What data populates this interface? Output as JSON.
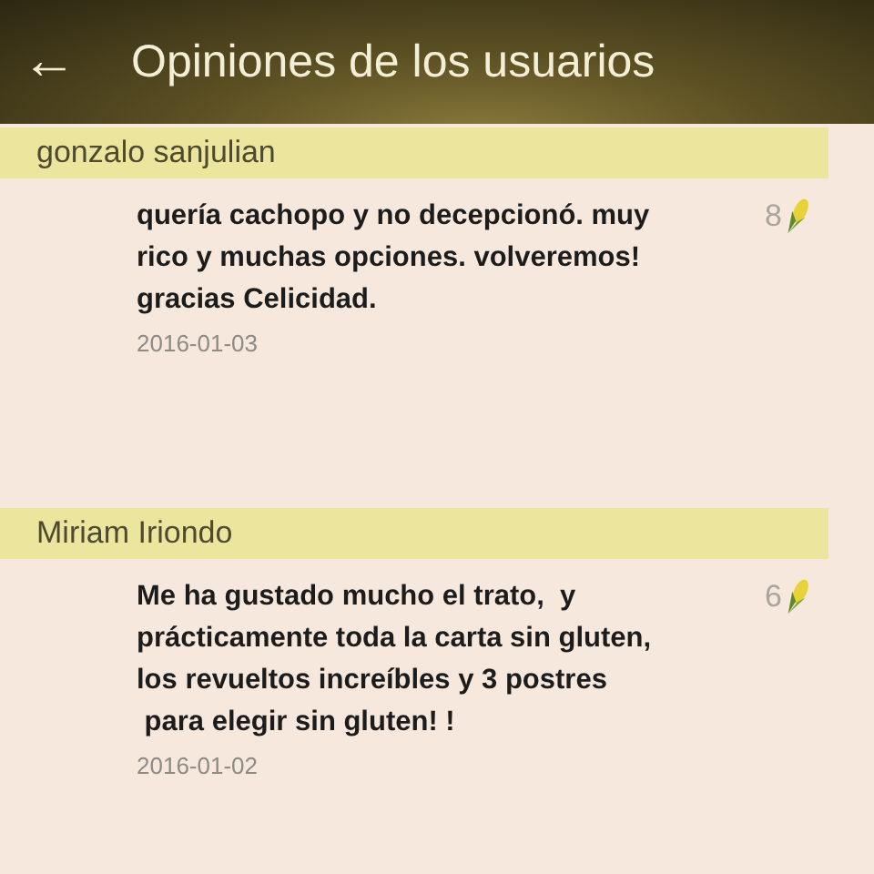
{
  "app_bar": {
    "back_icon": "←",
    "title": "Opiniones de los usuarios"
  },
  "reviews": [
    {
      "author": "gonzalo sanjulian",
      "text": "quería cachopo y no decepcionó. muy\nrico y muchas opciones. volveremos!\ngracias Celicidad.",
      "date": "2016-01-03",
      "score": "8"
    },
    {
      "author": "Miriam Iriondo",
      "text": "Me ha gustado mucho el trato,  y\nprácticamente toda la carta sin gluten,\nlos revueltos increíbles y 3 postres\n para elegir sin gluten! !",
      "date": "2016-01-02",
      "score": "6"
    }
  ]
}
